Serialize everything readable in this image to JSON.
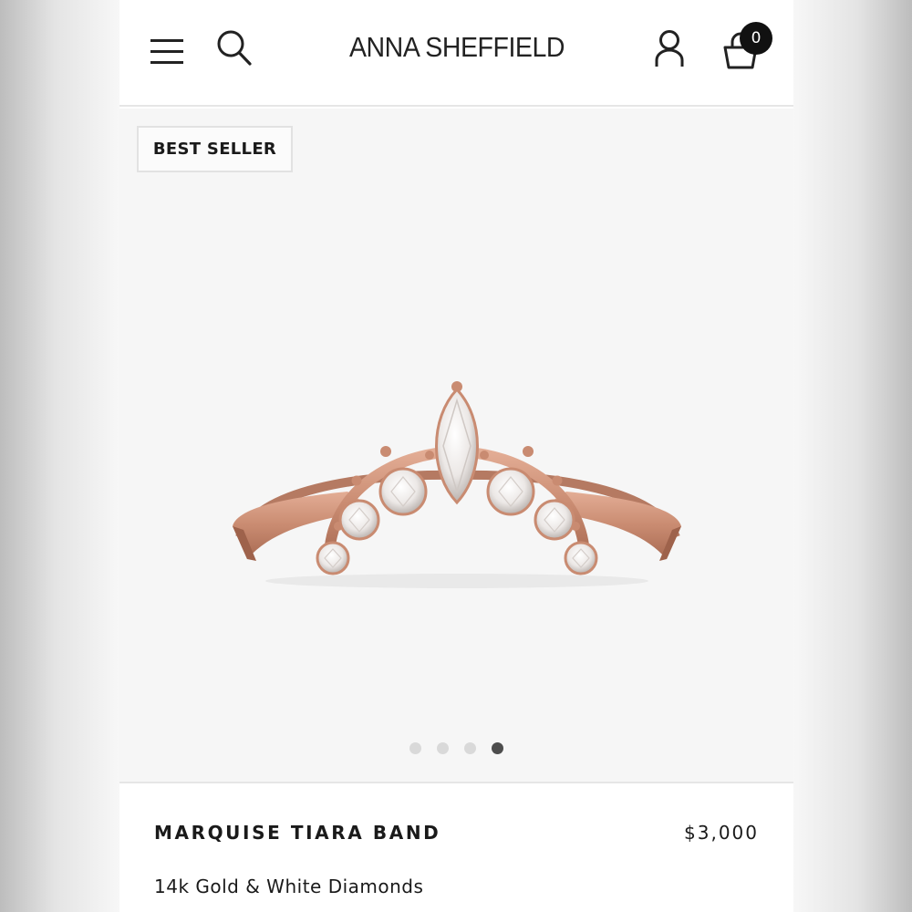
{
  "header": {
    "logo": "ANNA SHEFFIELD",
    "icons": {
      "menu": "hamburger-menu-icon",
      "search": "search-icon",
      "account": "user-icon",
      "cart": "shopping-bag-icon"
    },
    "cart_count": "0"
  },
  "gallery": {
    "badge": "BEST SELLER",
    "image": "rose-gold-marquise-tiara-band-ring",
    "dots_total": 4,
    "active_dot": 4
  },
  "product": {
    "name": "MARQUISE TIARA BAND",
    "price": "$3,000",
    "material": "14k Gold & White Diamonds"
  },
  "colors": {
    "text": "#1a1a1a",
    "metal": "#c98b71",
    "dot_active": "#4d4d4d",
    "dot_inactive": "#d9d9d9"
  }
}
